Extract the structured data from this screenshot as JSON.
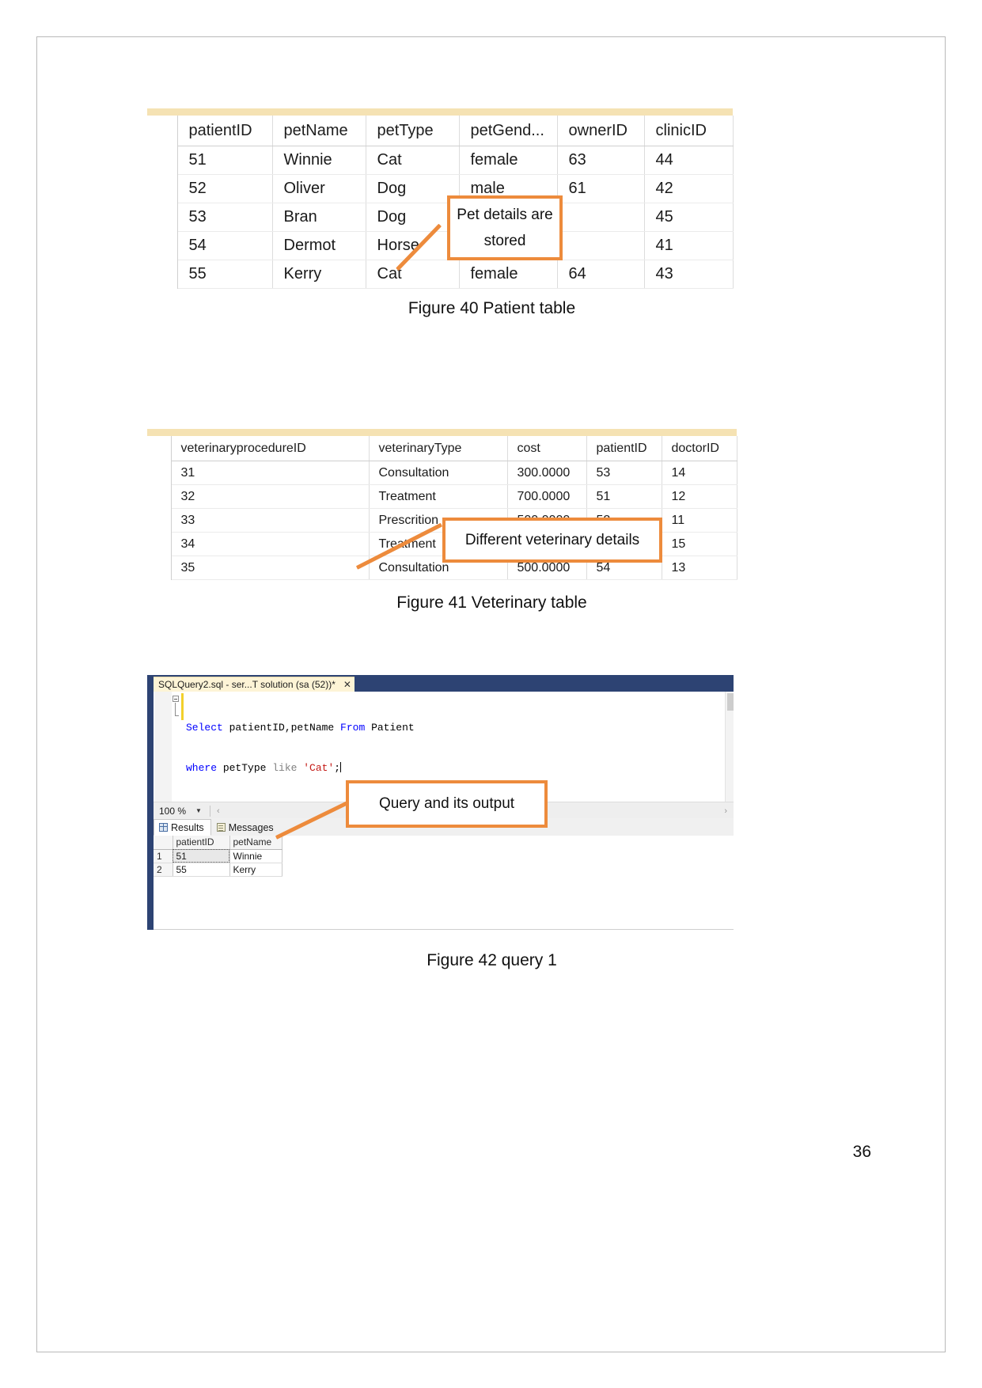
{
  "page": {
    "number": "36"
  },
  "figures": {
    "patient_caption": "Figure 40 Patient table",
    "veterinary_caption": "Figure 41 Veterinary table",
    "query_caption": "Figure 42 query 1"
  },
  "callouts": {
    "pet_details": "Pet details are stored",
    "veterinary_details": "Different veterinary details",
    "query_output": "Query and its output",
    "accent_color": "#ED8B3C"
  },
  "patient_table": {
    "columns": [
      "patientID",
      "petName",
      "petType",
      "petGend...",
      "ownerID",
      "clinicID"
    ],
    "rows": [
      [
        "51",
        "Winnie",
        "Cat",
        "female",
        "63",
        "44"
      ],
      [
        "52",
        "Oliver",
        "Dog",
        "male",
        "61",
        "42"
      ],
      [
        "53",
        "Bran",
        "Dog",
        "",
        "",
        "45"
      ],
      [
        "54",
        "Dermot",
        "Horse",
        "",
        "",
        "41"
      ],
      [
        "55",
        "Kerry",
        "Cat",
        "female",
        "64",
        "43"
      ]
    ]
  },
  "veterinary_table": {
    "columns": [
      "veterinaryprocedureID",
      "veterinaryType",
      "cost",
      "patientID",
      "doctorID"
    ],
    "rows": [
      [
        "31",
        "Consultation",
        "300.0000",
        "53",
        "14"
      ],
      [
        "32",
        "Treatment",
        "700.0000",
        "51",
        "12"
      ],
      [
        "33",
        "Prescrition",
        "500.0000",
        "52",
        "11"
      ],
      [
        "34",
        "Treatment",
        "",
        "",
        "15"
      ],
      [
        "35",
        "Consultation",
        "500.0000",
        "54",
        "13"
      ]
    ]
  },
  "ssms": {
    "tab_title": "SQLQuery2.sql - ser...T solution (sa (52))*",
    "tab_close": "✕",
    "code": {
      "line1": [
        {
          "t": "Select ",
          "c": "kw-blue"
        },
        {
          "t": "patientID,petName ",
          "c": "kw-black"
        },
        {
          "t": "From ",
          "c": "kw-blue"
        },
        {
          "t": "Patient",
          "c": "kw-black"
        }
      ],
      "line2": [
        {
          "t": "where ",
          "c": "kw-blue"
        },
        {
          "t": "petType ",
          "c": "kw-black"
        },
        {
          "t": "like ",
          "c": "kw-gray"
        },
        {
          "t": "'Cat'",
          "c": "kw-red"
        },
        {
          "t": ";",
          "c": "kw-black"
        }
      ]
    },
    "zoom_level": "100 %",
    "zoom_caret_icon": "chevron-down-icon",
    "results_tabs": [
      {
        "label": "Results",
        "icon": "grid-icon",
        "active": true
      },
      {
        "label": "Messages",
        "icon": "messages-icon",
        "active": false
      }
    ],
    "results_grid": {
      "columns": [
        "patientID",
        "petName"
      ],
      "rows": [
        {
          "num": "1",
          "cells": [
            "51",
            "Winnie"
          ]
        },
        {
          "num": "2",
          "cells": [
            "55",
            "Kerry"
          ]
        }
      ]
    }
  }
}
